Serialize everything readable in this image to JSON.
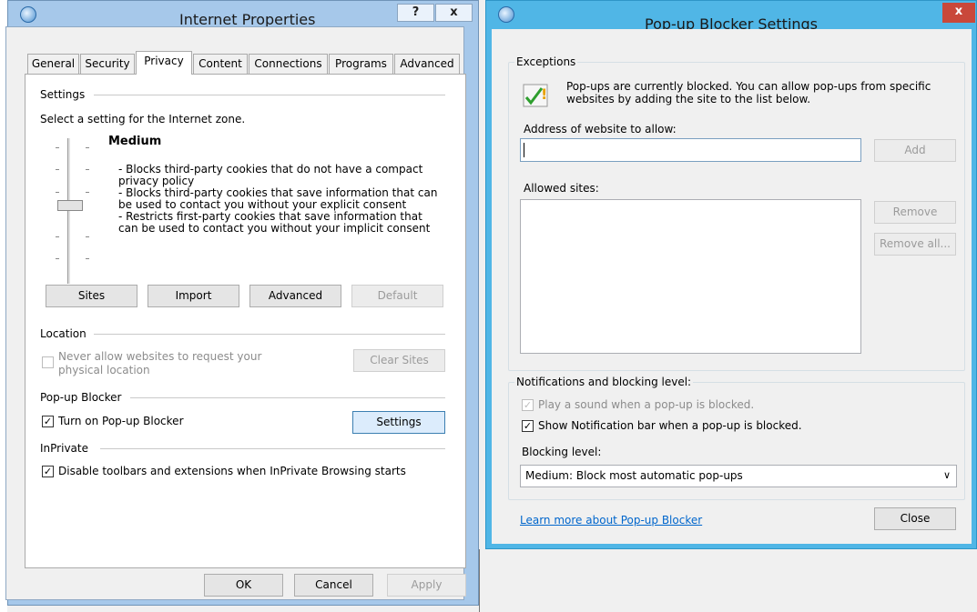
{
  "ip": {
    "title": "Internet Properties",
    "help_label": "?",
    "close_label": "x",
    "tabs": [
      "General",
      "Security",
      "Privacy",
      "Content",
      "Connections",
      "Programs",
      "Advanced"
    ],
    "settings": {
      "heading": "Settings",
      "zone_text": "Select a setting for the Internet zone.",
      "level": "Medium",
      "descriptions": [
        "- Blocks third-party cookies that do not have a compact",
        "privacy policy",
        "- Blocks third-party cookies that save information that can",
        "be used to contact you without your explicit consent",
        "- Restricts first-party cookies that save information that",
        "can be used to contact you without your implicit consent"
      ],
      "slider_level": 0.5,
      "buttons": {
        "sites": "Sites",
        "import": "Import",
        "advanced": "Advanced",
        "default": "Default"
      }
    },
    "location": {
      "heading": "Location",
      "never_allow_line1": "Never allow websites to request your",
      "never_allow_line2": "physical location",
      "never_allow_checked": false,
      "clear_sites": "Clear Sites"
    },
    "popup": {
      "heading": "Pop-up Blocker",
      "turn_on": "Turn on Pop-up Blocker",
      "turn_on_checked": true,
      "settings_button": "Settings"
    },
    "inprivate": {
      "heading": "InPrivate",
      "disable_toolbars": "Disable toolbars and extensions when InPrivate Browsing starts",
      "disable_toolbars_checked": true
    },
    "footer": {
      "ok": "OK",
      "cancel": "Cancel",
      "apply": "Apply"
    }
  },
  "pb": {
    "title": "Pop-up Blocker Settings",
    "close_label": "x",
    "exceptions": {
      "heading": "Exceptions",
      "info_line1": "Pop-ups are currently blocked.  You can allow pop-ups from specific",
      "info_line2": "websites by adding the site to the list below.",
      "address_label": "Address of website to allow:",
      "address_value": "",
      "add_button": "Add",
      "allowed_label": "Allowed sites:",
      "allowed_sites": [],
      "remove_button": "Remove",
      "remove_all_button": "Remove all..."
    },
    "notifications": {
      "heading": "Notifications and blocking level:",
      "play_sound": "Play a sound when a pop-up is blocked.",
      "play_sound_checked": true,
      "show_bar": "Show Notification bar when a pop-up is blocked.",
      "show_bar_checked": true,
      "blocking_label": "Blocking level:",
      "blocking_value": "Medium: Block most automatic pop-ups"
    },
    "learn_more": "Learn more about Pop-up Blocker",
    "close_button": "Close"
  },
  "colors": {
    "accent_blue": "#50b6e6",
    "link": "#0066cc",
    "check_green": "#2e9e2e"
  }
}
